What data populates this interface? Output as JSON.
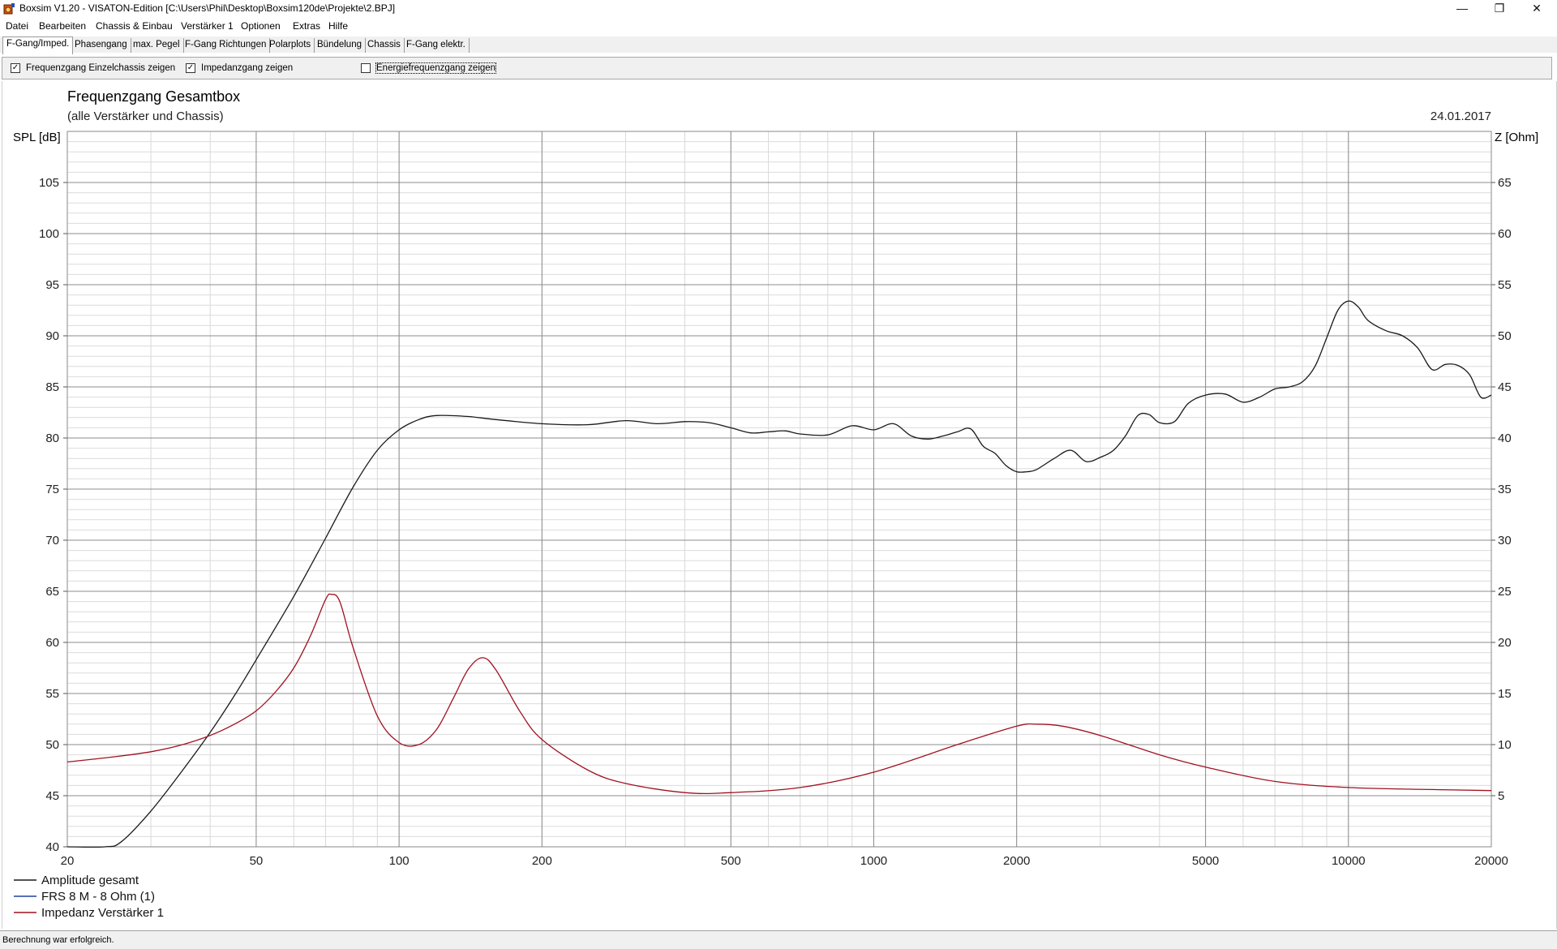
{
  "window": {
    "title": "Boxsim V1.20 - VISATON-Edition [C:\\Users\\Phil\\Desktop\\Boxsim120de\\Projekte\\2.BPJ]",
    "minimize_glyph": "—",
    "maximize_glyph": "❐",
    "close_glyph": "✕",
    "icon": "speaker-app-icon"
  },
  "menu": [
    "Datei",
    "Bearbeiten",
    "Chassis & Einbau",
    "Verstärker 1",
    "Optionen",
    "Extras",
    "Hilfe"
  ],
  "tabs": [
    "F-Gang/Imped.",
    "Phasengang",
    "max. Pegel",
    "F-Gang Richtungen",
    "Polarplots",
    "Bündelung",
    "Chassis",
    "F-Gang elektr."
  ],
  "active_tab": "F-Gang/Imped.",
  "options": {
    "single_chassis": {
      "label": "Frequenzgang Einzelchassis zeigen",
      "checked": true
    },
    "impedance": {
      "label": "Impedanzgang zeigen",
      "checked": true
    },
    "energy": {
      "label": "Energiefrequenzgang zeigen",
      "checked": false
    }
  },
  "status": "Berechnung war erfolgreich.",
  "chart_data": {
    "type": "line",
    "title": "Frequenzgang Gesamtbox",
    "subtitle": "(alle Verstärker und Chassis)",
    "date": "24.01.2017",
    "ylabel": "SPL [dB]",
    "y2label": "Z [Ohm]",
    "xscale": "log",
    "xlim": [
      20,
      20000
    ],
    "ylim": [
      40,
      110
    ],
    "y2lim": [
      0,
      70
    ],
    "xticks": [
      "20",
      "50",
      "100",
      "200",
      "500",
      "1000",
      "2000",
      "5000",
      "10000",
      "20000"
    ],
    "yticks": [
      "40",
      "45",
      "50",
      "55",
      "60",
      "65",
      "70",
      "75",
      "80",
      "85",
      "90",
      "95",
      "100",
      "105"
    ],
    "y2ticks": [
      "5",
      "10",
      "15",
      "20",
      "25",
      "30",
      "35",
      "40",
      "45",
      "50",
      "55",
      "60",
      "65"
    ],
    "grid": true,
    "legend_position": "bottom-left",
    "colors": {
      "amplitude": "#1a1a1a",
      "frs": "#2040a0",
      "impedance": "#a01020"
    },
    "series": [
      {
        "name": "Amplitude gesamt",
        "axis": "left",
        "x": [
          20,
          24,
          26,
          30,
          35,
          40,
          45,
          50,
          60,
          70,
          80,
          90,
          100,
          110,
          120,
          140,
          160,
          200,
          250,
          300,
          350,
          400,
          450,
          500,
          550,
          600,
          650,
          700,
          800,
          900,
          1000,
          1100,
          1200,
          1300,
          1400,
          1500,
          1600,
          1700,
          1800,
          1900,
          2000,
          2100,
          2200,
          2400,
          2600,
          2800,
          3000,
          3200,
          3400,
          3600,
          3800,
          4000,
          4300,
          4600,
          5000,
          5500,
          6000,
          6500,
          7000,
          7500,
          8000,
          8500,
          9000,
          9500,
          10000,
          10500,
          11000,
          12000,
          13000,
          14000,
          15000,
          16000,
          17000,
          18000,
          19000,
          20000
        ],
        "y": [
          40,
          40,
          40.5,
          43.5,
          47.5,
          51.2,
          54.8,
          58.3,
          64.5,
          70.2,
          75.2,
          78.8,
          80.8,
          81.8,
          82.2,
          82.1,
          81.8,
          81.4,
          81.3,
          81.7,
          81.4,
          81.6,
          81.5,
          81.0,
          80.5,
          80.6,
          80.7,
          80.4,
          80.3,
          81.2,
          80.8,
          81.4,
          80.2,
          79.9,
          80.2,
          80.6,
          80.9,
          79.2,
          78.5,
          77.3,
          76.7,
          76.7,
          76.9,
          78.0,
          78.8,
          77.7,
          78.1,
          78.8,
          80.3,
          82.2,
          82.3,
          81.5,
          81.6,
          83.4,
          84.2,
          84.3,
          83.5,
          84.0,
          84.8,
          85.0,
          85.5,
          87.0,
          89.8,
          92.5,
          93.4,
          92.8,
          91.5,
          90.5,
          90.0,
          88.8,
          86.7,
          87.2,
          87.1,
          86.2,
          84.0,
          84.2
        ]
      },
      {
        "name": "FRS 8 M - 8 Ohm (1)",
        "axis": "left",
        "x": [],
        "y": []
      },
      {
        "name": "Impedanz Verstärker 1",
        "axis": "right",
        "x": [
          20,
          25,
          30,
          35,
          40,
          45,
          50,
          55,
          60,
          65,
          70,
          72,
          75,
          80,
          90,
          100,
          110,
          120,
          130,
          140,
          150,
          160,
          180,
          200,
          250,
          300,
          400,
          500,
          700,
          1000,
          1500,
          2000,
          2200,
          2500,
          3000,
          4000,
          5000,
          7000,
          10000,
          15000,
          20000
        ],
        "y": [
          8.3,
          8.8,
          9.3,
          10.0,
          10.9,
          12.0,
          13.3,
          15.2,
          17.5,
          20.6,
          24.2,
          24.7,
          24.0,
          19.5,
          12.8,
          10.2,
          10.0,
          11.5,
          14.5,
          17.4,
          18.5,
          17.3,
          13.2,
          10.5,
          7.5,
          6.2,
          5.3,
          5.3,
          5.8,
          7.3,
          10.0,
          11.8,
          12.0,
          11.8,
          10.9,
          9.0,
          7.8,
          6.4,
          5.8,
          5.6,
          5.5
        ]
      }
    ]
  }
}
